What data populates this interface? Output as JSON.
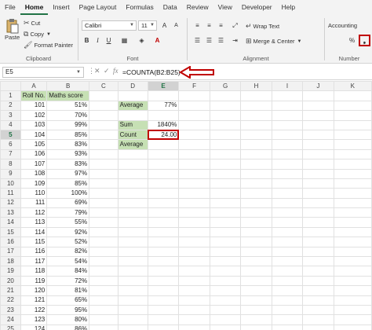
{
  "menu": {
    "tabs": [
      "File",
      "Home",
      "Insert",
      "Page Layout",
      "Formulas",
      "Data",
      "Review",
      "View",
      "Developer",
      "Help"
    ],
    "active": "Home"
  },
  "ribbon": {
    "clipboard": {
      "paste": "Paste",
      "cut": "Cut",
      "copy": "Copy",
      "format_painter": "Format Painter",
      "label": "Clipboard"
    },
    "font": {
      "font_name": "Calibri",
      "font_size": "11",
      "label": "Font"
    },
    "alignment": {
      "wrap_text": "Wrap Text",
      "merge_center": "Merge & Center",
      "label": "Alignment"
    },
    "number": {
      "format": "Accounting",
      "label": "Number"
    }
  },
  "formula_bar": {
    "name_box": "E5",
    "formula": "=COUNTA(B2:B25)"
  },
  "sheet": {
    "columns": [
      "A",
      "B",
      "C",
      "D",
      "E",
      "F",
      "G",
      "H",
      "I",
      "J",
      "K"
    ],
    "headers": {
      "A1": "Roll No.",
      "B1": "Maths score"
    },
    "rows": [
      {
        "n": "1"
      },
      {
        "n": "2",
        "a": "101",
        "b": "51%",
        "d": "Average",
        "e": "77%"
      },
      {
        "n": "3",
        "a": "102",
        "b": "70%"
      },
      {
        "n": "4",
        "a": "103",
        "b": "99%",
        "d": "Sum",
        "e": "1840%"
      },
      {
        "n": "5",
        "a": "104",
        "b": "85%",
        "d": "Count",
        "e": "24.00"
      },
      {
        "n": "6",
        "a": "105",
        "b": "83%",
        "d": "Average",
        "e": ""
      },
      {
        "n": "7",
        "a": "106",
        "b": "93%"
      },
      {
        "n": "8",
        "a": "107",
        "b": "83%"
      },
      {
        "n": "9",
        "a": "108",
        "b": "97%"
      },
      {
        "n": "10",
        "a": "109",
        "b": "85%"
      },
      {
        "n": "11",
        "a": "110",
        "b": "100%"
      },
      {
        "n": "12",
        "a": "111",
        "b": "69%"
      },
      {
        "n": "13",
        "a": "112",
        "b": "79%"
      },
      {
        "n": "14",
        "a": "113",
        "b": "55%"
      },
      {
        "n": "15",
        "a": "114",
        "b": "92%"
      },
      {
        "n": "16",
        "a": "115",
        "b": "52%"
      },
      {
        "n": "17",
        "a": "116",
        "b": "82%"
      },
      {
        "n": "18",
        "a": "117",
        "b": "54%"
      },
      {
        "n": "19",
        "a": "118",
        "b": "84%"
      },
      {
        "n": "20",
        "a": "119",
        "b": "72%"
      },
      {
        "n": "21",
        "a": "120",
        "b": "81%"
      },
      {
        "n": "22",
        "a": "121",
        "b": "65%"
      },
      {
        "n": "23",
        "a": "122",
        "b": "95%"
      },
      {
        "n": "24",
        "a": "123",
        "b": "80%"
      },
      {
        "n": "25",
        "a": "124",
        "b": "86%"
      }
    ]
  },
  "icons": {
    "paste": "clipboard-icon",
    "cut": "scissors-icon",
    "copy": "copy-icon",
    "format_painter": "paintbrush-icon",
    "wrap": "wrap-text-icon",
    "merge": "merge-icon",
    "percent": "percent-icon",
    "comma": "comma-style-icon",
    "callout": "arrow-left-icon"
  },
  "colors": {
    "header_fill": "#c6e0b4",
    "highlight": "#c00000",
    "accent": "#217346"
  }
}
